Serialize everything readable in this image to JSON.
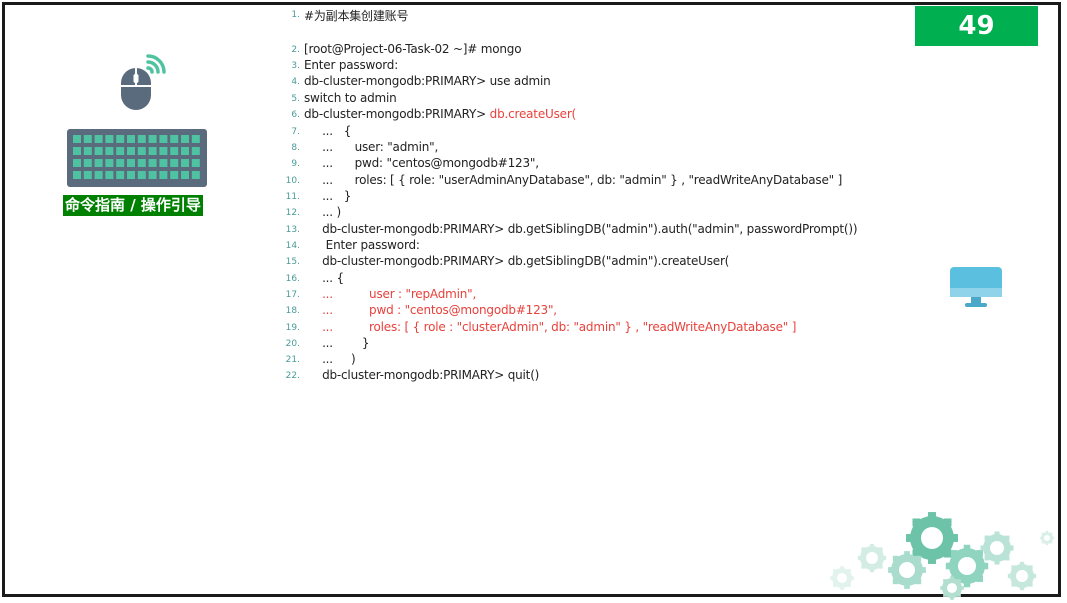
{
  "page_number": "49",
  "guide_label": "命令指南 / 操作引导",
  "colors": {
    "badge": "#00b050",
    "label_bg": "#008000",
    "highlight": "#e8413b",
    "line_number": "#4a9a9a",
    "icon_slate": "#5a6b7d",
    "icon_teal": "#4fc3a1",
    "monitor_blue": "#5bc0e0"
  },
  "icons": {
    "mouse": "wireless-mouse-icon",
    "keyboard": "keyboard-icon",
    "monitor": "monitor-icon",
    "decoration": "gears-decoration"
  },
  "code_lines": [
    {
      "n": "1.",
      "parts": [
        {
          "t": "#为副本集创建账号",
          "red": false
        }
      ]
    },
    {
      "n": "2.",
      "parts": [
        {
          "t": "[root@Project-06-Task-02 ~]# mongo",
          "red": false
        }
      ]
    },
    {
      "n": "3.",
      "parts": [
        {
          "t": "Enter password:",
          "red": false
        }
      ]
    },
    {
      "n": "4.",
      "parts": [
        {
          "t": "db-cluster-mongodb:PRIMARY> use admin",
          "red": false
        }
      ]
    },
    {
      "n": "5.",
      "parts": [
        {
          "t": "switch to admin",
          "red": false
        }
      ]
    },
    {
      "n": "6.",
      "parts": [
        {
          "t": "db-cluster-mongodb:PRIMARY> ",
          "red": false
        },
        {
          "t": "db.createUser(",
          "red": true
        }
      ]
    },
    {
      "n": "7.",
      "parts": [
        {
          "t": "     ...   {",
          "red": false
        }
      ]
    },
    {
      "n": "8.",
      "parts": [
        {
          "t": "     ...      user: \"admin\",",
          "red": false
        }
      ]
    },
    {
      "n": "9.",
      "parts": [
        {
          "t": "     ...      pwd: \"centos@mongodb#123\",",
          "red": false
        }
      ]
    },
    {
      "n": "10.",
      "parts": [
        {
          "t": "     ...      roles: [ { role: \"userAdminAnyDatabase\", db: \"admin\" } , \"readWriteAnyDatabase\" ]",
          "red": false
        }
      ]
    },
    {
      "n": "11.",
      "parts": [
        {
          "t": "     ...   }",
          "red": false
        }
      ]
    },
    {
      "n": "12.",
      "parts": [
        {
          "t": "     ... )",
          "red": false
        }
      ]
    },
    {
      "n": "13.",
      "parts": [
        {
          "t": "     db-cluster-mongodb:PRIMARY> db.getSiblingDB(\"admin\").auth(\"admin\", passwordPrompt())",
          "red": false
        }
      ]
    },
    {
      "n": "14.",
      "parts": [
        {
          "t": "      Enter password:",
          "red": false
        }
      ]
    },
    {
      "n": "15.",
      "parts": [
        {
          "t": "     db-cluster-mongodb:PRIMARY> db.getSiblingDB(\"admin\").createUser(",
          "red": false
        }
      ]
    },
    {
      "n": "16.",
      "parts": [
        {
          "t": "     ... {",
          "red": false
        }
      ]
    },
    {
      "n": "17.",
      "parts": [
        {
          "t": "     ...          user : \"repAdmin\",",
          "red": true
        }
      ]
    },
    {
      "n": "18.",
      "parts": [
        {
          "t": "     ...          pwd : \"centos@mongodb#123\",",
          "red": true
        }
      ]
    },
    {
      "n": "19.",
      "parts": [
        {
          "t": "     ...          roles: [ { role : \"clusterAdmin\", db: \"admin\" } , \"readWriteAnyDatabase\" ]",
          "red": true
        }
      ]
    },
    {
      "n": "20.",
      "parts": [
        {
          "t": "     ...        }",
          "red": false
        }
      ]
    },
    {
      "n": "21.",
      "parts": [
        {
          "t": "     ...     )",
          "red": false
        }
      ]
    },
    {
      "n": "22.",
      "parts": [
        {
          "t": "     db-cluster-mongodb:PRIMARY> quit()",
          "red": false
        }
      ]
    }
  ]
}
